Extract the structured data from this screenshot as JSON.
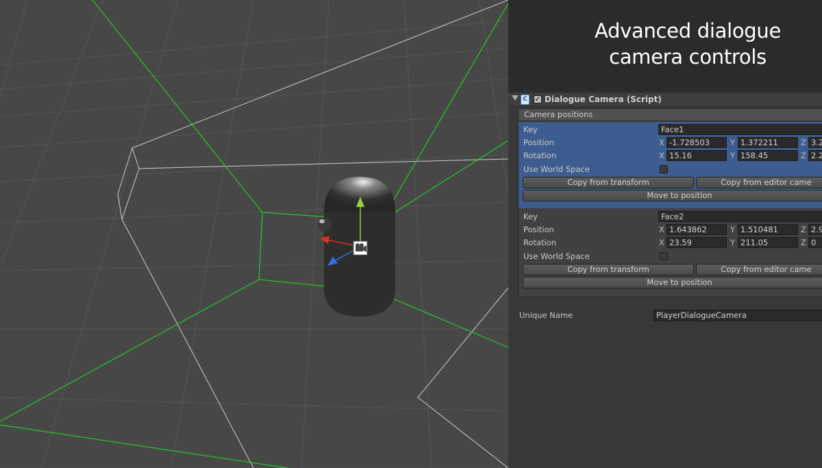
{
  "headline": {
    "line1": "Advanced dialogue",
    "line2": "camera controls"
  },
  "component": {
    "title": "Dialogue Camera (Script)",
    "icon": "script-icon",
    "enabled": true
  },
  "list": {
    "header": "Camera positions",
    "entries": [
      {
        "key_label": "Key",
        "key": "Face1",
        "position_label": "Position",
        "pos_x": "-1.728503",
        "pos_y": "1.372211",
        "pos_z": "3.2",
        "rotation_label": "Rotation",
        "rot_x": "15.16",
        "rot_y": "158.45",
        "rot_z": "2.2",
        "world_label": "Use World Space",
        "copy_transform": "Copy from transform",
        "copy_editor": "Copy from editor came",
        "move": "Move to position",
        "selected": true
      },
      {
        "key_label": "Key",
        "key": "Face2",
        "position_label": "Position",
        "pos_x": "1.643862",
        "pos_y": "1.510481",
        "pos_z": "2.9",
        "rotation_label": "Rotation",
        "rot_x": "23.59",
        "rot_y": "211.05",
        "rot_z": "0",
        "world_label": "Use World Space",
        "copy_transform": "Copy from transform",
        "copy_editor": "Copy from editor came",
        "move": "Move to position",
        "selected": false
      }
    ]
  },
  "unique_name": {
    "label": "Unique Name",
    "value": "PlayerDialogueCamera"
  },
  "axes": {
    "x": "X",
    "y": "Y",
    "z": "Z"
  },
  "colors": {
    "selection": "#3d5c8f",
    "frustum": "#22cc22",
    "gizmo_x": "#d8321e",
    "gizmo_y": "#8fd43a",
    "gizmo_z": "#2f6fe0"
  }
}
